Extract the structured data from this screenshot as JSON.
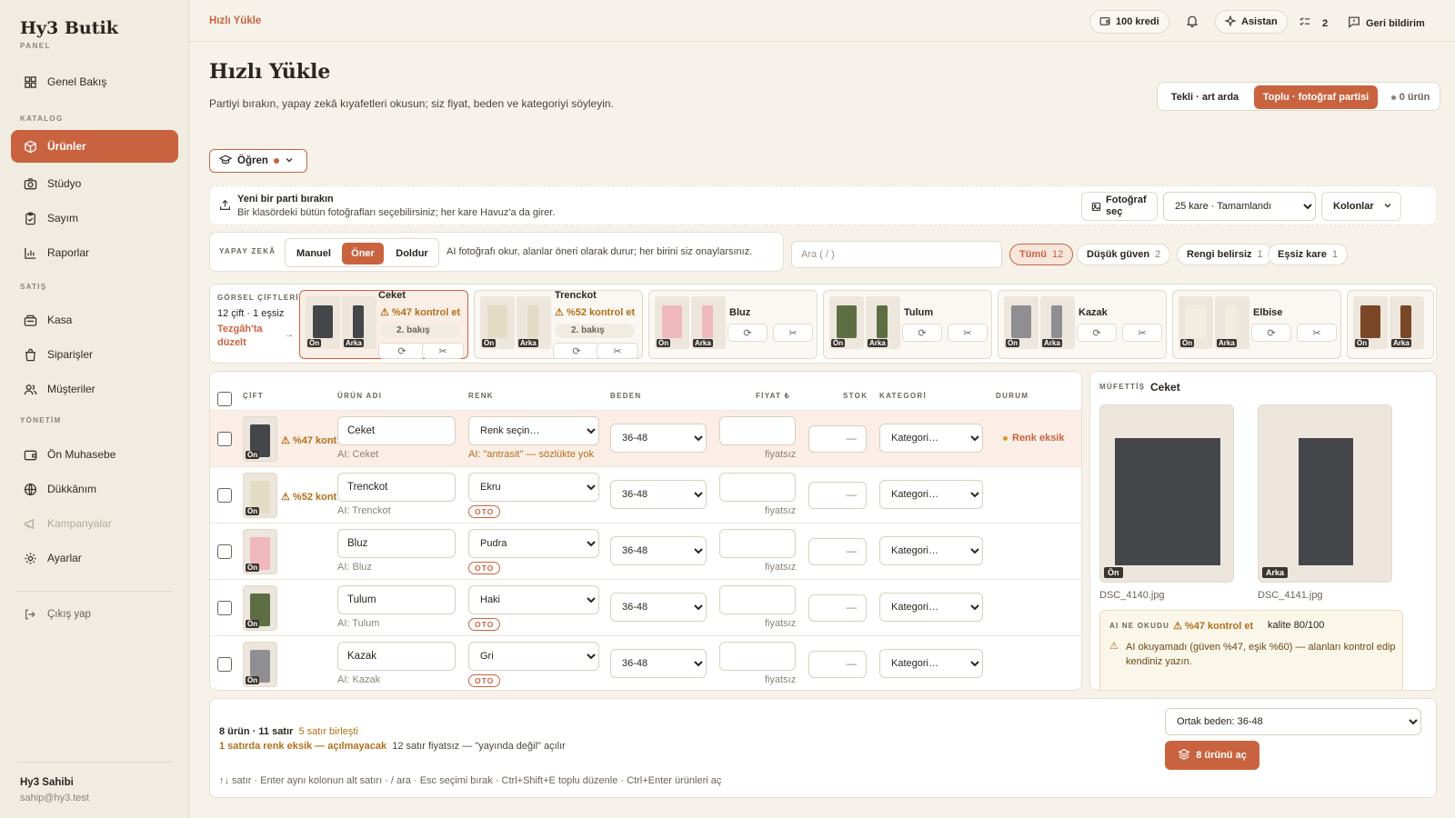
{
  "brand": {
    "name": "Hy3 Butik",
    "sub": "PANEL"
  },
  "sidebar": {
    "overview": "Genel Bakış",
    "sections": {
      "catalog": "KATALOG",
      "sales": "SATIŞ",
      "management": "YÖNETİM"
    },
    "items": {
      "products": "Ürünler",
      "studio": "Stüdyo",
      "count": "Sayım",
      "reports": "Raporlar",
      "pos": "Kasa",
      "orders": "Siparişler",
      "customers": "Müşteriler",
      "accounting": "Ön Muhasebe",
      "shop": "Dükkânım",
      "campaigns": "Kampanyalar",
      "settings": "Ayarlar"
    },
    "logout": "Çıkış yap",
    "user": {
      "name": "Hy3 Sahibi",
      "email": "sahip@hy3.test"
    }
  },
  "topbar": {
    "breadcrumb": "Hızlı Yükle",
    "credits": "100  kredi",
    "assistant": "Asistan",
    "tasks": "2",
    "feedback": "Geri bildirim"
  },
  "page": {
    "title": "Hızlı Yükle",
    "subtitle": "Partiyi bırakın, yapay zekâ kıyafetleri okusun; siz fiyat, beden ve kategoriyi söyleyin.",
    "mode_single": "Tekli · art arda",
    "mode_bulk": "Toplu · fotoğraf partisi",
    "product_count": "0 ürün",
    "learn": "Öğren"
  },
  "dropzone": {
    "title": "Yeni bir parti bırakın",
    "desc": "Bir klasördeki bütün fotoğrafları seçebilirsiniz; her kare Havuz'a da girer.",
    "pick_photo": "Fotoğraf seç",
    "batch_status": "25 kare · Tamamlandı",
    "columns": "Kolonlar"
  },
  "ai": {
    "label": "YAPAY ZEKÂ",
    "modes": [
      "Manuel",
      "Öner",
      "Doldur"
    ],
    "desc": "AI fotoğrafı okur, alanlar öneri olarak durur; her birini siz onaylarsınız.",
    "search_placeholder": "Ara  ( / )"
  },
  "filters": [
    {
      "label": "Tümü",
      "count": "12"
    },
    {
      "label": "Düşük güven",
      "count": "2"
    },
    {
      "label": "Rengi belirsiz",
      "count": "1"
    },
    {
      "label": "Eşsiz kare",
      "count": "1"
    }
  ],
  "pairs": {
    "label": "GÖRSEL ÇİFTLERİ",
    "count": "12 çift · 1 eşsiz",
    "link": "Tezgâh'ta düzelt",
    "front": "Ön",
    "back": "Arka",
    "items": [
      {
        "name": "Ceket",
        "warn": "%47 kontrol et",
        "view": "2. bakış",
        "color": "#45464a"
      },
      {
        "name": "Trenckot",
        "warn": "%52 kontrol et",
        "view": "2. bakış",
        "color": "#e3dcc4"
      },
      {
        "name": "Bluz",
        "color": "#efb8bd"
      },
      {
        "name": "Tulum",
        "color": "#5d6e43"
      },
      {
        "name": "Kazak",
        "color": "#8f8f93"
      },
      {
        "name": "Elbise",
        "color": "#f2eedf"
      },
      {
        "name": "",
        "color": "#7a4726"
      }
    ]
  },
  "table": {
    "headers": {
      "pair": "ÇİFT",
      "name": "ÜRÜN ADI",
      "color": "RENK",
      "size": "BEDEN",
      "price": "FİYAT ₺",
      "stock": "STOK",
      "category": "KATEGORİ",
      "status": "DURUM"
    },
    "rows": [
      {
        "name": "Ceket",
        "ai": "AI: Ceket",
        "color": "Renk seçin…",
        "color_note": "AI: \"antrasit\" — sözlükte yok",
        "size": "36-48",
        "price_note": "fiyatsız",
        "stock": "—",
        "category": "Kategori…",
        "status": "Renk eksik",
        "warn": "%47 kontrol et",
        "swatch": "#45464a"
      },
      {
        "name": "Trenckot",
        "ai": "AI: Trenckot",
        "color": "Ekru",
        "oto": "OTO",
        "size": "36-48",
        "price_note": "fiyatsız",
        "stock": "—",
        "category": "Kategori…",
        "warn": "%52 kontrol et",
        "swatch": "#e3dcc4"
      },
      {
        "name": "Bluz",
        "ai": "AI: Bluz",
        "color": "Pudra",
        "oto": "OTO",
        "size": "36-48",
        "price_note": "fiyatsız",
        "stock": "—",
        "category": "Kategori…",
        "swatch": "#efb8bd"
      },
      {
        "name": "Tulum",
        "ai": "AI: Tulum",
        "color": "Haki",
        "oto": "OTO",
        "size": "36-48",
        "price_note": "fiyatsız",
        "stock": "—",
        "category": "Kategori…",
        "swatch": "#5d6e43"
      },
      {
        "name": "Kazak",
        "ai": "AI: Kazak",
        "color": "Gri",
        "oto": "OTO",
        "size": "36-48",
        "price_note": "fiyatsız",
        "stock": "—",
        "category": "Kategori…",
        "swatch": "#8f8f93"
      }
    ],
    "front_tag": "Ön"
  },
  "inspector": {
    "label": "MÜFETTİŞ",
    "name": "Ceket",
    "front": "Ön",
    "back": "Arka",
    "front_file": "DSC_4140.jpg",
    "back_file": "DSC_4141.jpg",
    "ai_label": "AI NE OKUDU",
    "warn": "%47 kontrol et",
    "quality": "kalite 80/100",
    "message": "AI okuyamadı (güven %47, eşik %60) — alanları kontrol edip kendiniz yazın."
  },
  "footer": {
    "summary": "8 ürün · 11 satır",
    "merged": "5 satır birleşti",
    "missing": "1 satırda renk eksik — açılmayacak",
    "unpriced": "12 satır fiyatsız — \"yayında değil\" açılır",
    "shortcuts": "↑↓ satır · Enter aynı kolonun alt satırı · / ara · Esc seçimi bırak · Ctrl+Shift+E toplu düzenle · Ctrl+Enter ürünleri aç",
    "common_size": "Ortak beden: 36-48",
    "open_button": "8 ürünü aç"
  },
  "colors": {
    "accent": "#c9633f",
    "warning": "#b0701a",
    "background": "#f6f2ea"
  }
}
